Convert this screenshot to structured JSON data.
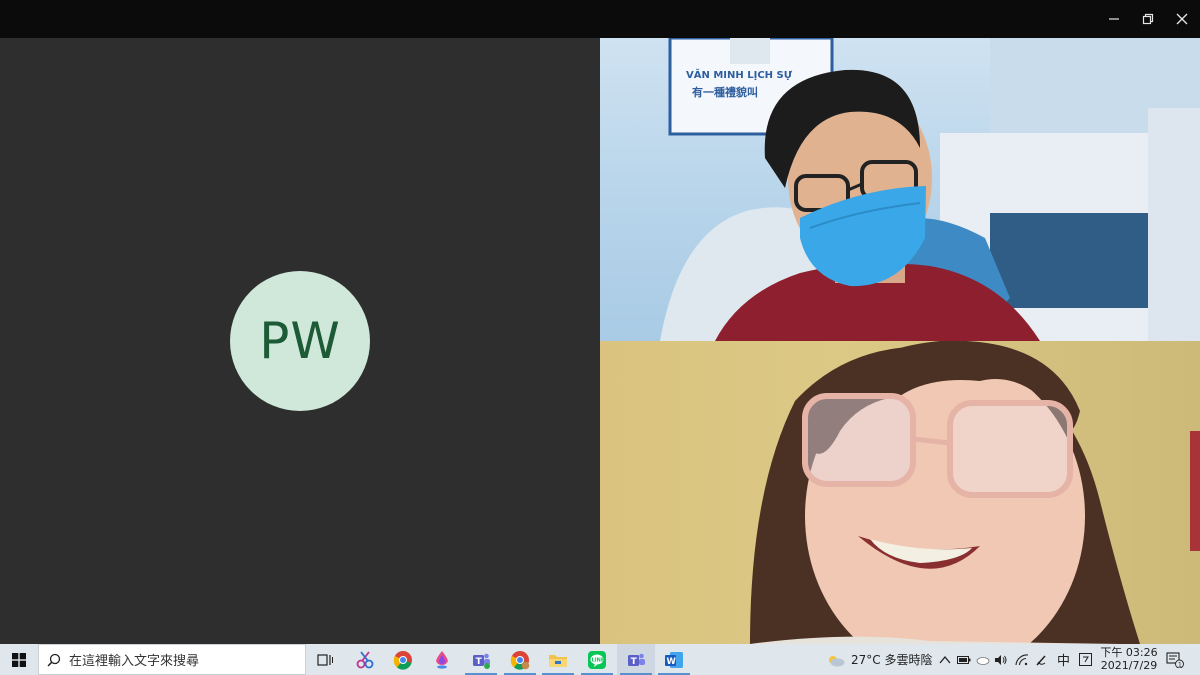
{
  "window": {
    "controls": [
      "minimize-icon",
      "restore-icon",
      "close-icon"
    ]
  },
  "participants": [
    {
      "initials": "PW",
      "avatar_bg": "#cfe8da",
      "avatar_fg": "#1d5a36"
    }
  ],
  "video_top": {
    "poster_line1": "VĂN MINH LỊCH SỰ",
    "poster_line2": "有一種禮貌叫"
  },
  "taskbar": {
    "search_placeholder": "在這裡輸入文字來搜尋",
    "apps": [
      "task-view-icon",
      "snip-icon",
      "chrome-icon",
      "firefox-icon",
      "teams-icon",
      "chrome-profile-icon",
      "file-explorer-icon",
      "line-icon",
      "teams-icon-2",
      "word-icon"
    ],
    "weather": "27°C 多雲時陰",
    "ime": "中",
    "time": "下午 03:26",
    "date": "2021/7/29",
    "notification_count": "1"
  }
}
